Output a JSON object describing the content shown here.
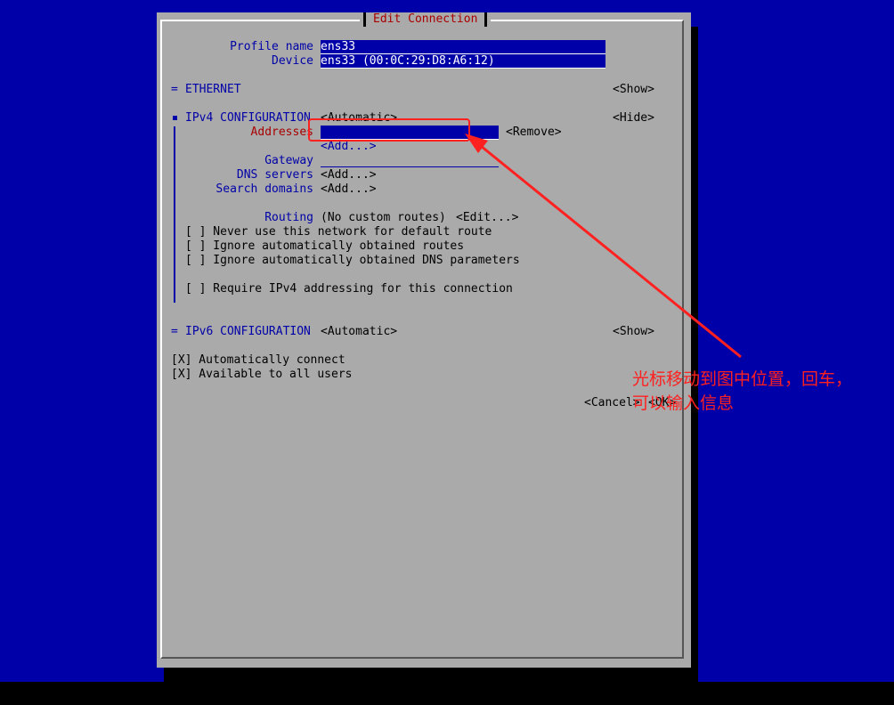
{
  "dialog": {
    "title": "Edit Connection",
    "profile_name_label": "Profile name",
    "profile_name_value": "ens33",
    "device_label": "Device",
    "device_value": "ens33 (00:0C:29:D8:A6:12)"
  },
  "ethernet": {
    "marker": "=",
    "label": "ETHERNET",
    "toggle": "<Show>"
  },
  "ipv4": {
    "marker": "■",
    "label": "IPv4 CONFIGURATION",
    "mode": "<Automatic>",
    "toggle": "<Hide>",
    "addresses_label": "Addresses",
    "addresses_value": "",
    "remove": "<Remove>",
    "add_address": "<Add...>",
    "gateway_label": "Gateway",
    "dns_label": "DNS servers",
    "dns_add": "<Add...>",
    "search_label": "Search domains",
    "search_add": "<Add...>",
    "routing_label": "Routing",
    "routing_value": "(No custom routes)",
    "routing_edit": "<Edit...>",
    "checkbox_never_default": "[ ] Never use this network for default route",
    "checkbox_ignore_routes": "[ ] Ignore automatically obtained routes",
    "checkbox_ignore_dns": "[ ] Ignore automatically obtained DNS parameters",
    "checkbox_require_ipv4": "[ ] Require IPv4 addressing for this connection"
  },
  "ipv6": {
    "marker": "=",
    "label": "IPv6 CONFIGURATION",
    "mode": "<Automatic>",
    "toggle": "<Show>"
  },
  "options": {
    "auto_connect": "[X] Automatically connect",
    "all_users": "[X] Available to all users"
  },
  "buttons": {
    "cancel": "<Cancel>",
    "ok": "<OK>"
  },
  "annotation": {
    "line1": "光标移动到图中位置，回车，",
    "line2": "可以输入信息",
    "color": "#ff2020"
  }
}
